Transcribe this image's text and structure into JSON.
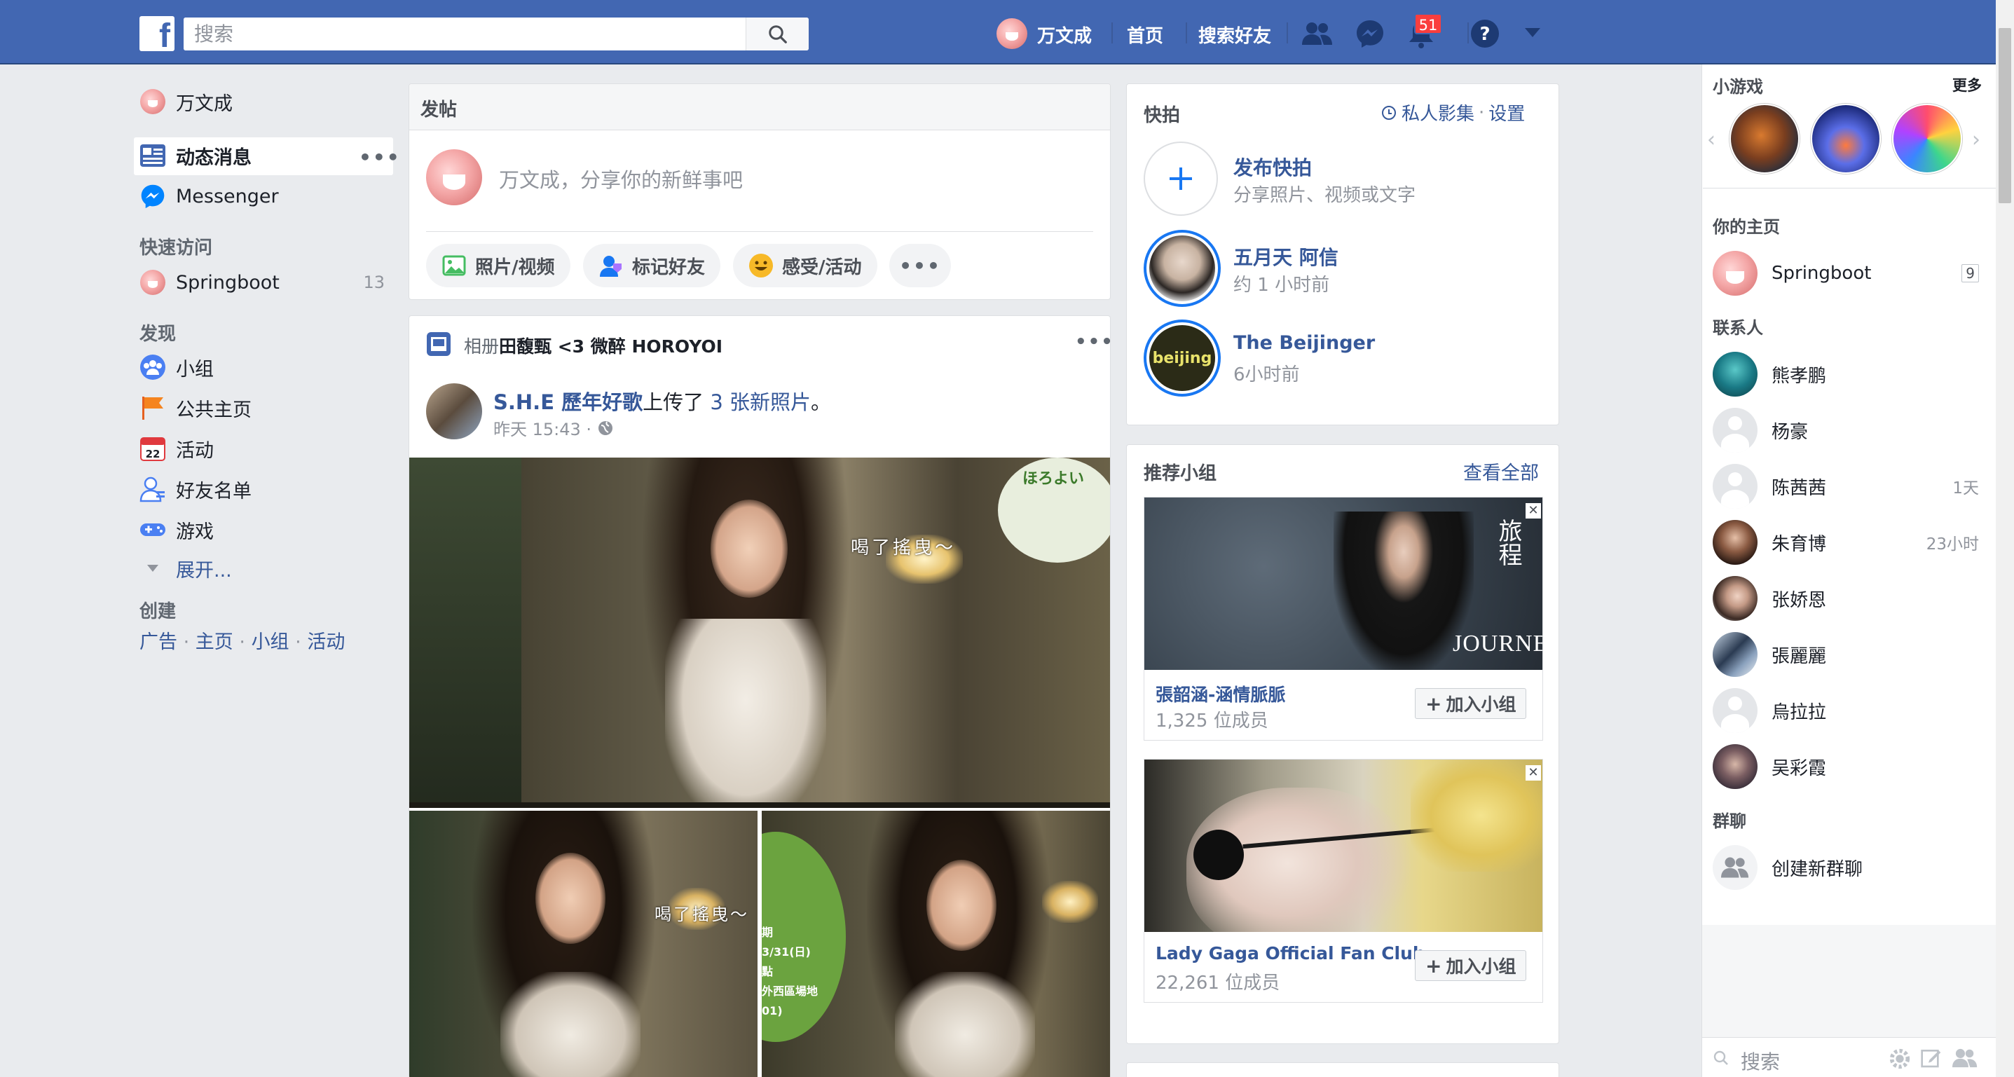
{
  "topbar": {
    "logo": "f",
    "search_placeholder": "搜索",
    "user_name": "万文成",
    "home": "首页",
    "find_friends": "搜索好友",
    "notif_count": "51"
  },
  "left_nav": {
    "user_name": "万文成",
    "news_feed": "动态消息",
    "messenger": "Messenger",
    "shortcuts_title": "快速访问",
    "shortcut_name": "Springboot",
    "shortcut_count": "13",
    "explore_title": "发现",
    "explore_items": [
      "小组",
      "公共主页",
      "活动",
      "好友名单",
      "游戏"
    ],
    "events_icon_day": "22",
    "see_more": "展开...",
    "create_title": "创建",
    "create_links": [
      "广告",
      "主页",
      "小组",
      "活动"
    ],
    "create_sep": "·"
  },
  "composer": {
    "title": "发帖",
    "placeholder": "万文成，分享你的新鲜事吧",
    "photo_video": "照片/视频",
    "tag_friends": "标记好友",
    "feeling": "感受/活动"
  },
  "post": {
    "album_prefix": "相册",
    "album_name": "田馥甄 <3 微醉 HOROYOI",
    "author": "S.H.E 歷年好歌",
    "action": "上传了",
    "photos_link": "3 张新照片",
    "action_end": "。",
    "time": "昨天 15:43 ·",
    "caption_1": "喝了搖曳～",
    "caption_2": "喝了搖曳～",
    "logo_text": "ほろよい",
    "side_text": [
      "期",
      "3/31(日)",
      "點",
      "外西區場地",
      "01)"
    ]
  },
  "stories": {
    "title": "快拍",
    "archive": "私人影集",
    "sep": "·",
    "settings": "设置",
    "items": [
      {
        "name": "发布快拍",
        "sub": "分享照片、视频或文字"
      },
      {
        "name": "五月天 阿信",
        "sub": "约 1 小时前"
      },
      {
        "name": "The Beijinger",
        "sub": "6小时前"
      }
    ],
    "beijinger_logo": "beijing"
  },
  "groups": {
    "title": "推荐小组",
    "see_all": "查看全部",
    "items": [
      {
        "name": "張韶涵-涵情脈脈",
        "members": "1,325 位成员",
        "join": "加入小组",
        "photo_text": "JOURNEY",
        "photo_vtext": "旅程"
      },
      {
        "name": "Lady Gaga Official Fan Club",
        "members": "22,261 位成员",
        "join": "加入小组"
      }
    ]
  },
  "sidebar": {
    "games_title": "小游戏",
    "more": "更多",
    "pages_title": "你的主页",
    "page_name": "Springboot",
    "page_count": "9",
    "contacts_title": "联系人",
    "contacts": [
      {
        "name": "熊孝鹏",
        "time": ""
      },
      {
        "name": "杨豪",
        "time": ""
      },
      {
        "name": "陈茜茜",
        "time": "1天"
      },
      {
        "name": "朱育博",
        "time": "23小时"
      },
      {
        "name": "张娇恩",
        "time": ""
      },
      {
        "name": "張麗麗",
        "time": ""
      },
      {
        "name": "烏拉拉",
        "time": ""
      },
      {
        "name": "吴彩霞",
        "time": ""
      }
    ],
    "group_chats_title": "群聊",
    "new_group": "创建新群聊",
    "search_placeholder": "搜索"
  },
  "colors": {
    "brand": "#4267b2",
    "link": "#365899",
    "badge": "#fa3e3e"
  }
}
